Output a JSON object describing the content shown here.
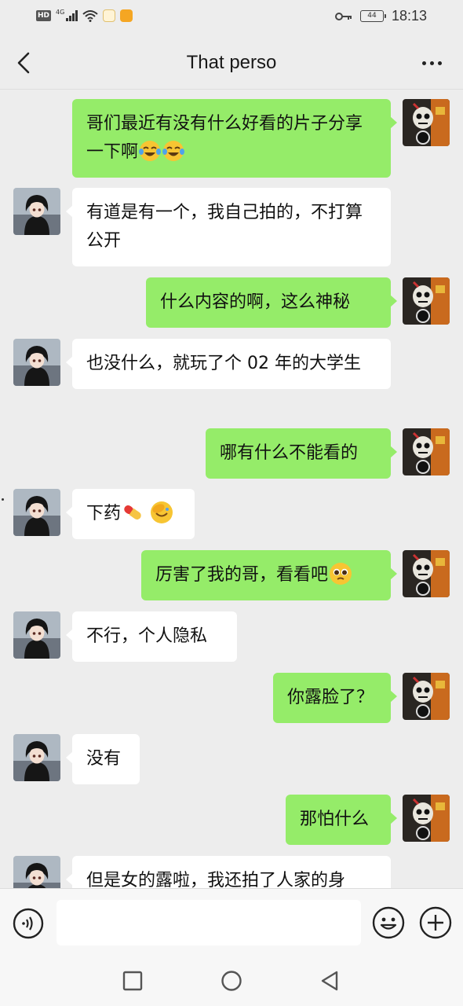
{
  "status_bar": {
    "hd": "HD",
    "network": "4G",
    "battery": "44",
    "time": "18:13",
    "icons": [
      "signal-icon",
      "wifi-icon",
      "app-notification-icon",
      "key-icon"
    ]
  },
  "header": {
    "title": "That perso",
    "back_icon": "chevron-left-icon",
    "more_icon": "more-dots-icon"
  },
  "messages": [
    {
      "from": "me",
      "text": "哥们最近有没有什么好看的片子分享一下啊",
      "emojis": [
        "laughing-tears",
        "laughing-tears"
      ]
    },
    {
      "from": "them",
      "text": "有道是有一个，我自己拍的，不打算公开",
      "emojis": []
    },
    {
      "from": "me",
      "text": "什么内容的啊，这么神秘",
      "emojis": []
    },
    {
      "from": "them",
      "text": "也没什么，就玩了个 02 年的大学生",
      "emojis": []
    },
    {
      "from": "me",
      "text": "哪有什么不能看的",
      "emojis": []
    },
    {
      "from": "them",
      "text": "下药",
      "emojis": [
        "pill",
        "facepalm"
      ]
    },
    {
      "from": "me",
      "text": "厉害了我的哥，看看吧",
      "emojis": [
        "pleading"
      ]
    },
    {
      "from": "them",
      "text": "不行，个人隐私",
      "emojis": []
    },
    {
      "from": "me",
      "text": "你露脸了？",
      "emojis": []
    },
    {
      "from": "them",
      "text": "没有",
      "emojis": []
    },
    {
      "from": "me",
      "text": "那怕什么",
      "emojis": []
    },
    {
      "from": "them",
      "text": "但是女的露啦，我还拍了人家的身",
      "emojis": []
    }
  ],
  "input_bar": {
    "voice_icon": "voice-icon",
    "emoji_icon": "emoji-icon",
    "plus_icon": "plus-icon",
    "text_value": ""
  },
  "nav_bar": {
    "icons": [
      "recent-apps-icon",
      "home-icon",
      "back-icon"
    ]
  },
  "colors": {
    "background": "#ededed",
    "my_bubble": "#95ec69",
    "their_bubble": "#ffffff"
  }
}
